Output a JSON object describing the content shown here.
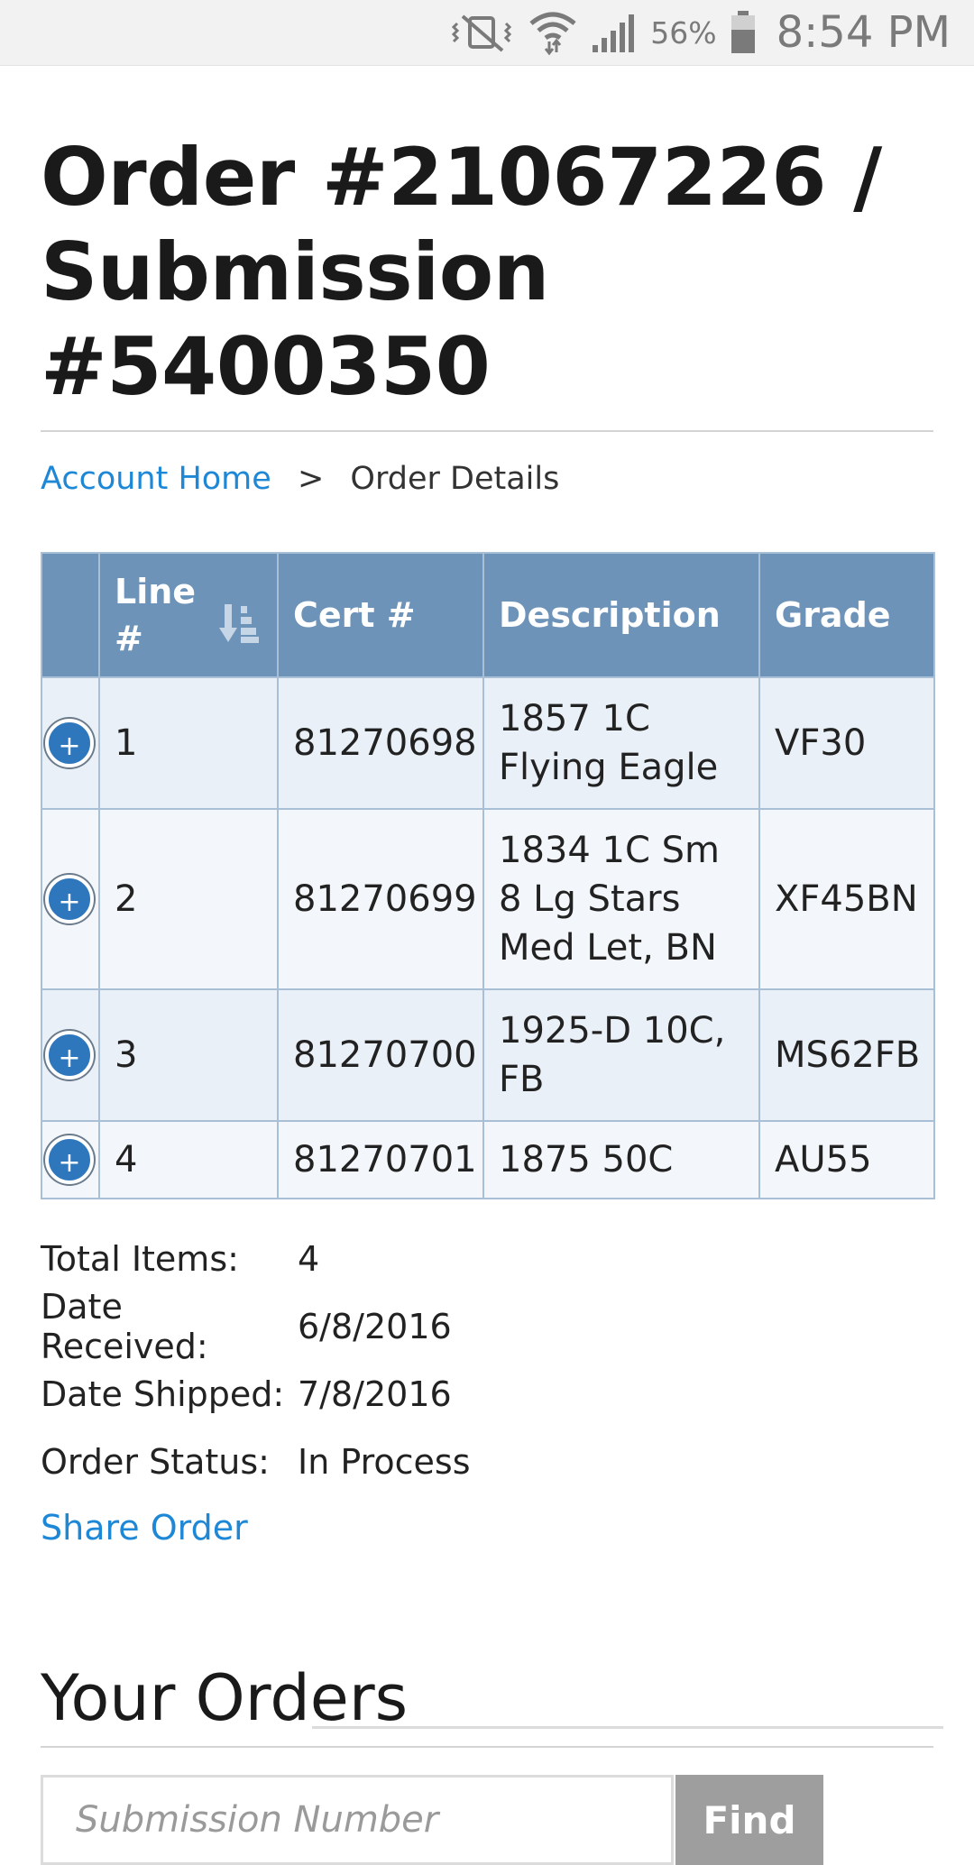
{
  "status_bar": {
    "icons": [
      "mute-vibrate-icon",
      "wifi-icon",
      "signal-icon",
      "battery-icon"
    ],
    "battery_percent": "56%",
    "time": "8:54 PM"
  },
  "page": {
    "title": "Order #21067226 / Submission #5400350",
    "breadcrumb": {
      "home_label": "Account Home",
      "separator": ">",
      "current": "Order Details"
    }
  },
  "table": {
    "headers": [
      "",
      "Line #",
      "Cert #",
      "Description",
      "Grade"
    ],
    "expand_symbol": "+",
    "rows": [
      {
        "line": "1",
        "cert": "81270698",
        "description": "1857 1C Flying Eagle",
        "grade": "VF30"
      },
      {
        "line": "2",
        "cert": "81270699",
        "description": "1834 1C Sm 8 Lg Stars Med Let, BN",
        "grade": "XF45BN"
      },
      {
        "line": "3",
        "cert": "81270700",
        "description": "1925-D 10C, FB",
        "grade": "MS62FB"
      },
      {
        "line": "4",
        "cert": "81270701",
        "description": "1875 50C",
        "grade": "AU55"
      }
    ]
  },
  "summary": {
    "total_items_label": "Total Items:",
    "total_items": "4",
    "date_received_label": "Date Received:",
    "date_received": "6/8/2016",
    "date_shipped_label": "Date Shipped:",
    "date_shipped": "7/8/2016",
    "order_status_label": "Order Status:",
    "order_status": "In Process",
    "share_label": "Share Order"
  },
  "your_orders": {
    "heading": "Your Orders",
    "search_placeholder": "Submission Number",
    "find_label": "Find"
  },
  "colors": {
    "header_bg": "#6d93b9",
    "link": "#1e88d6",
    "expand_button": "#2f77bd",
    "find_button": "#9e9e9e"
  }
}
